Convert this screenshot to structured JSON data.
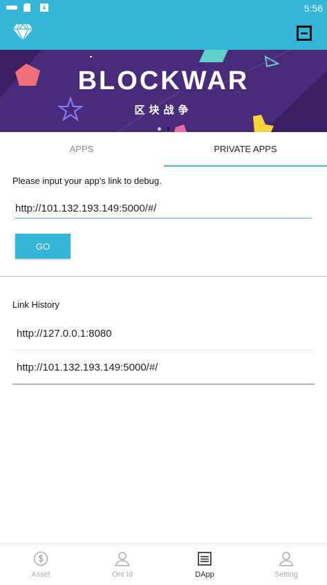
{
  "status_bar": {
    "time": "5:56"
  },
  "banner": {
    "title": "BLOCKWAR",
    "subtitle": "区块战争"
  },
  "tabs": [
    {
      "label": "APPS",
      "active": false
    },
    {
      "label": "PRIVATE APPS",
      "active": true
    }
  ],
  "debug": {
    "prompt": "Please input your app's link to debug.",
    "url_value": "http://101.132.193.149:5000/#/",
    "go_label": "GO"
  },
  "history": {
    "title": "Link History",
    "items": [
      "http://127.0.0.1:8080",
      "http://101.132.193.149:5000/#/"
    ]
  },
  "bottom_nav": [
    {
      "label": "Asset",
      "icon": "dollar-circle-icon",
      "active": false
    },
    {
      "label": "Ont Id",
      "icon": "person-icon",
      "active": false
    },
    {
      "label": "DApp",
      "icon": "list-icon",
      "active": true
    },
    {
      "label": "Setting",
      "icon": "person-icon",
      "active": false
    }
  ],
  "colors": {
    "accent": "#34b6d9",
    "banner_bg": "#4a2a7a"
  }
}
